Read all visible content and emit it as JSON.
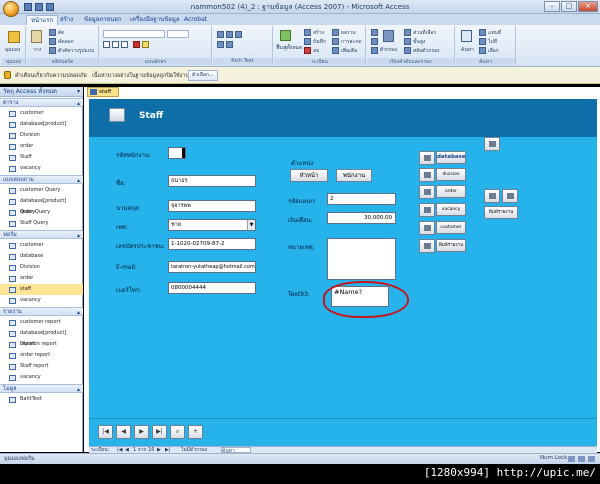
{
  "window": {
    "title": "nammon502 (4)_2 : ฐานข้อมูล (Access 2007) - Microsoft Access"
  },
  "ribbon": {
    "tabs": [
      "หน้าแรก",
      "สร้าง",
      "ข้อมูลภายนอก",
      "เครื่องมือฐานข้อมูล",
      "Acrobat"
    ],
    "groups": [
      "มุมมอง",
      "คลิปบอร์ด",
      "แบบอักษร",
      "Rich Text",
      "ระเบียน",
      "เรียงลำดับและกรอง",
      "ค้นหา"
    ],
    "view_label": "มุมมอง",
    "paste_label": "วาง",
    "clip_items": [
      "ตัด",
      "คัดลอก",
      "ตัวคัดวางรูปแบบ"
    ],
    "refresh_label": "ฟื้นฟูทั้งหมด",
    "record_items": [
      "สร้าง",
      "บันทึก",
      "ลบ"
    ],
    "record_items2": [
      "ผลรวม",
      "การสะกด",
      "เพิ่มเติม"
    ],
    "sort_label": "ตัวกรอง",
    "sort_items": [
      "ส่วนที่เลือก",
      "ขั้นสูง",
      "สลับตัวกรอง"
    ],
    "find_label": "ค้นหา",
    "find_items": [
      "แทนที่",
      "ไปที่",
      "เลือก"
    ]
  },
  "security": {
    "icon": "shield-warning-icon",
    "text": "คำเตือนเกี่ยวกับความปลอดภัย",
    "detail": "เนื้อหาบางอย่างในฐานข้อมูลถูกปิดใช้งาน",
    "options_label": "ตัวเลือก..."
  },
  "nav": {
    "header": "วัตถุ Access ทั้งหมด",
    "groups": [
      {
        "name": "ตาราง",
        "items": [
          "customer",
          "database[product]",
          "Division",
          "order",
          "Staff",
          "vacancy"
        ]
      },
      {
        "name": "แบบสอบถาม",
        "items": [
          "customer Query",
          "database[product] Query",
          "order Query",
          "Staff Query"
        ]
      },
      {
        "name": "ฟอร์ม",
        "items": [
          "customer",
          "database",
          "Division",
          "order",
          "staff",
          "vacancy"
        ]
      },
      {
        "name": "รายงาน",
        "items": [
          "customer report",
          "database[product] report",
          "Division report",
          "order report",
          "Staff report",
          "vacancy"
        ]
      },
      {
        "name": "โมดูล",
        "items": [
          "BahtText"
        ]
      }
    ]
  },
  "doc": {
    "tab_label": "staff",
    "form_title": "Staff",
    "fields": {
      "staff_id_label": "รหัสพนักงาน:",
      "staff_id_value": "",
      "name_label": "ชื่อ:",
      "name_value": "ธนาธร",
      "surname_label": "นามสกุล:",
      "surname_value": "จุจารพพ",
      "sex_label": "เพศ:",
      "sex_value": "ชาย",
      "idcard_label": "เลขบัตรประชาชน:",
      "idcard_value": "1-1020-02709-87-2",
      "email_label": "E-mail:",
      "email_value": "taratron-yutatheap@hotmail.com",
      "phone_label": "เบอร์โทร:",
      "phone_value": "0800004444",
      "position_label": "ตำแหน่ง",
      "pos_btn1": "หัวหน้า",
      "pos_btn2": "พนักงาน",
      "section_label": "รหัสแผนก:",
      "section_value": "2",
      "salary_label": "เงินเดือน:",
      "salary_value": "30,000.00",
      "note_label": "หมายเหตุ:",
      "note_value": "",
      "text_label": "Text93:",
      "text_value": "#Name?"
    },
    "side_buttons": [
      "database",
      "division",
      "order",
      "vacancy",
      "customer",
      "พิมพ์รายงาน"
    ],
    "print_label": "พิมพ์รายงาน",
    "record_nav": {
      "prefix": "ระเบียน:",
      "position": "1 จาก 16",
      "filter": "ไม่มีตัวกรอง",
      "search": "ค้นหา"
    }
  },
  "status": {
    "left": "มุมมองฟอร์ม",
    "right": "Num Lock"
  },
  "watermark": "[1280x994] http://upic.me/",
  "colors": {
    "form_header": "#0e6ea8",
    "form_body": "#26b3ec",
    "annotation": "#c4161c"
  }
}
